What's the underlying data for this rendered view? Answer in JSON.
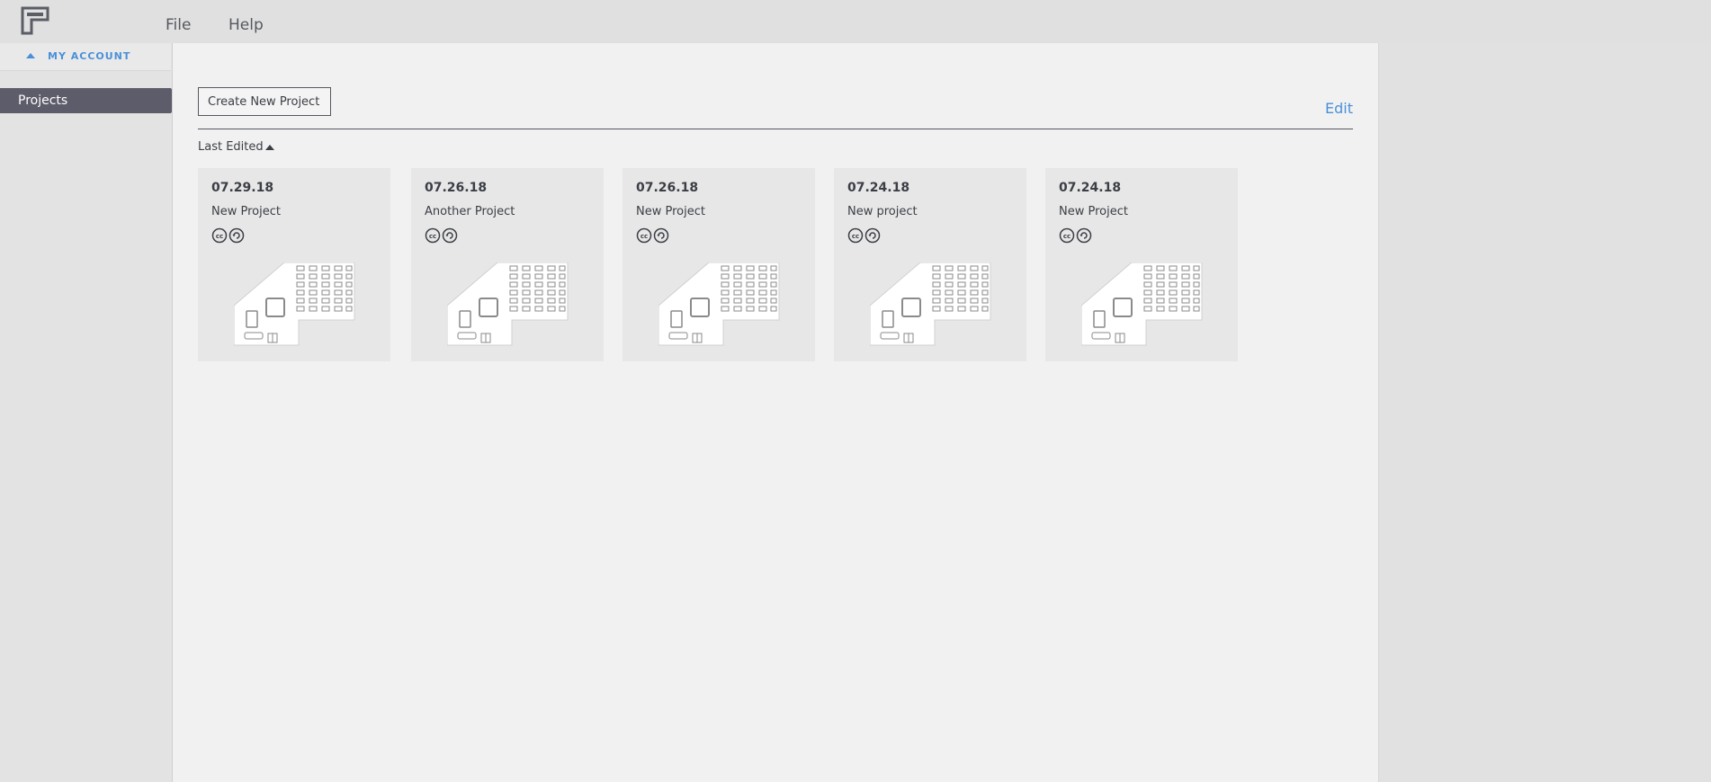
{
  "topbar": {
    "menu": [
      {
        "label": "File"
      },
      {
        "label": "Help"
      }
    ]
  },
  "sidebar": {
    "account_label": "MY ACCOUNT",
    "items": [
      {
        "label": "Projects",
        "active": true
      }
    ]
  },
  "toolbar": {
    "create_label": "Create New Project",
    "edit_label": "Edit"
  },
  "sort": {
    "label": "Last Edited",
    "direction": "ascending"
  },
  "projects": [
    {
      "date": "07.29.18",
      "name": "New Project",
      "license_icons": [
        "cc-icon",
        "share-alike-icon"
      ]
    },
    {
      "date": "07.26.18",
      "name": "Another Project",
      "license_icons": [
        "cc-icon",
        "share-alike-icon"
      ]
    },
    {
      "date": "07.26.18",
      "name": "New Project",
      "license_icons": [
        "cc-icon",
        "share-alike-icon"
      ]
    },
    {
      "date": "07.24.18",
      "name": "New project",
      "license_icons": [
        "cc-icon",
        "share-alike-icon"
      ]
    },
    {
      "date": "07.24.18",
      "name": "New Project",
      "license_icons": [
        "cc-icon",
        "share-alike-icon"
      ]
    }
  ],
  "colors": {
    "accent": "#4a90d9",
    "nav_active": "#5d5c6a",
    "text": "#3b3e45"
  }
}
